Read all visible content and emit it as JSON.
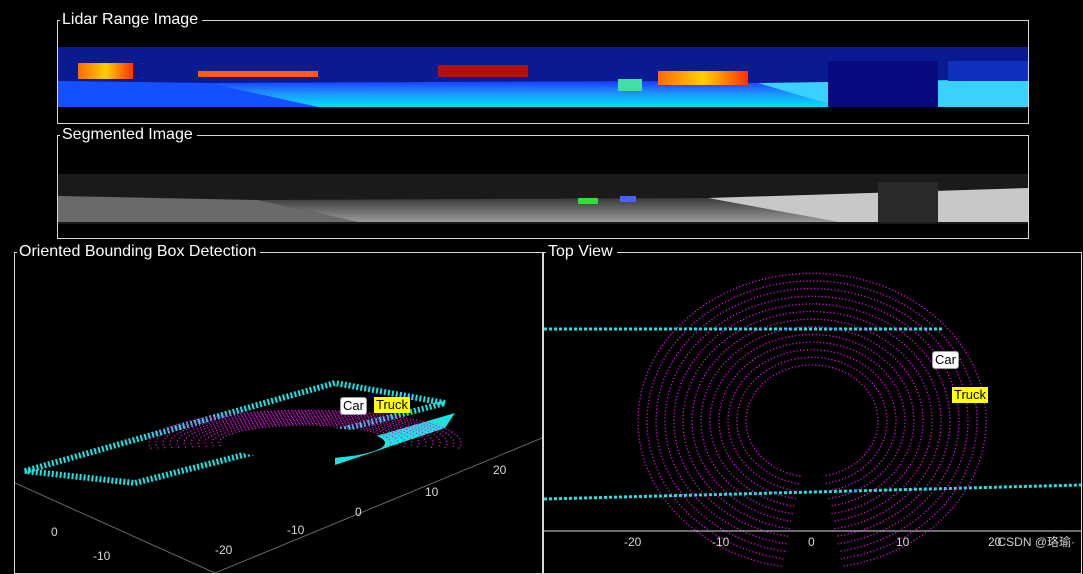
{
  "panels": {
    "range": {
      "title": "Lidar Range Image"
    },
    "segmented": {
      "title": "Segmented Image"
    },
    "obb": {
      "title": "Oriented Bounding Box Detection",
      "labels": {
        "car": "Car",
        "truck": "Truck"
      },
      "ticks_x": [
        "-20",
        "-10",
        "0"
      ],
      "ticks_y": [
        "10",
        "20"
      ],
      "ticks_left": [
        "0",
        "-10"
      ]
    },
    "top": {
      "title": "Top View",
      "labels": {
        "car": "Car",
        "truck": "Truck"
      },
      "ticks_x": [
        "-20",
        "-10",
        "0",
        "10",
        "20"
      ]
    }
  },
  "watermark": "CSDN @珞瑜·",
  "colors": {
    "background": "#000000",
    "frame": "#d8d8d8",
    "points_ground": "#e010e0",
    "points_obstacle": "#20e0e0",
    "car_label_bg": "#ffffff",
    "truck_label_bg": "#ffff00",
    "car_box": "#1a9cff",
    "truck_box": "#30e030"
  }
}
